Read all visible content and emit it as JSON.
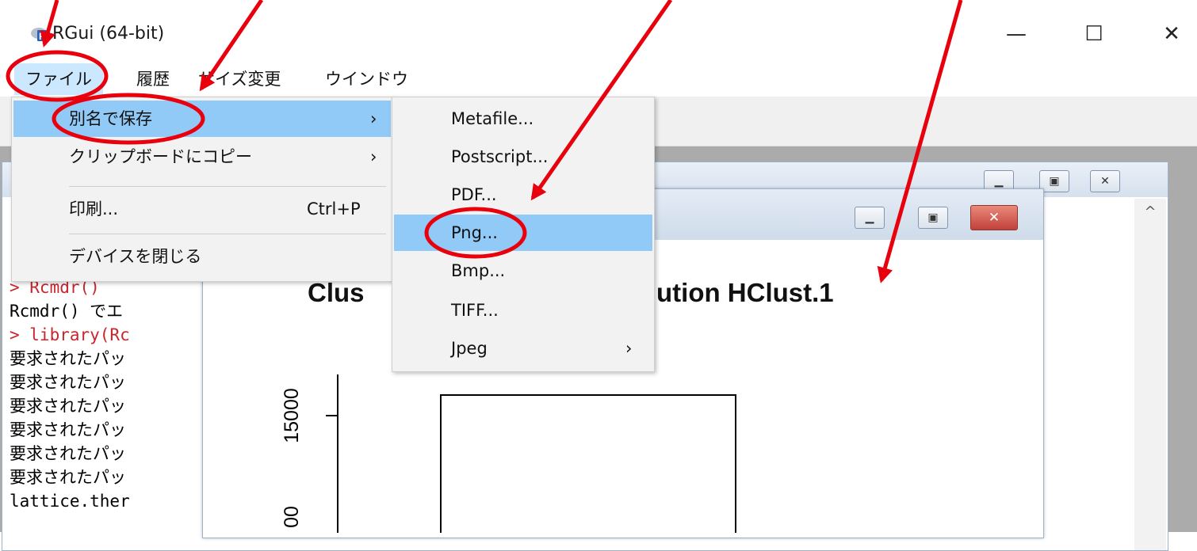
{
  "window": {
    "title": "RGui (64-bit)",
    "controls": {
      "minimize": "—",
      "maximize": "☐",
      "close": "✕"
    }
  },
  "menubar": {
    "items": [
      {
        "label": "ファイル"
      },
      {
        "label": "履歴"
      },
      {
        "label": "サイズ変更"
      },
      {
        "label": "ウインドウ"
      }
    ]
  },
  "file_menu": {
    "items": [
      {
        "label": "別名で保存",
        "has_submenu": true,
        "arrow": "›"
      },
      {
        "label": "クリップボードにコピー",
        "has_submenu": true,
        "arrow": "›"
      },
      {
        "label": "印刷...",
        "shortcut": "Ctrl+P"
      },
      {
        "label": "デバイスを閉じる"
      }
    ]
  },
  "save_as_submenu": {
    "items": [
      {
        "label": "Metafile..."
      },
      {
        "label": "Postscript..."
      },
      {
        "label": "PDF..."
      },
      {
        "label": "Png..."
      },
      {
        "label": "Bmp..."
      },
      {
        "label": "TIFF..."
      },
      {
        "label": "Jpeg",
        "arrow": "›"
      }
    ]
  },
  "console": {
    "lines": [
      {
        "text": "> Rcmdr()",
        "color": "#c7262e"
      },
      {
        "text": " Rcmdr() でエ"
      },
      {
        "text": "> library(Rc",
        "color": "#c7262e"
      },
      {
        "text": " 要求されたパッ"
      },
      {
        "text": " 要求されたパッ"
      },
      {
        "text": " 要求されたパッ"
      },
      {
        "text": " 要求されたパッ"
      },
      {
        "text": " 要求されたパッ"
      },
      {
        "text": " 要求されたパッ"
      },
      {
        "text": " lattice.ther"
      }
    ],
    "scroll_up": "^"
  },
  "graphics": {
    "title_partial": "Clus",
    "title_rest": "for Solution HClust.1",
    "ytick_15000": "15000",
    "ytick_partial": "00",
    "controls": {
      "minimize": "▁",
      "maximize": "▣",
      "close": "✕"
    }
  },
  "colors": {
    "annotation_red": "#e8000d",
    "menu_highlight": "#91c9f7",
    "menubar_active": "#cce8ff"
  }
}
